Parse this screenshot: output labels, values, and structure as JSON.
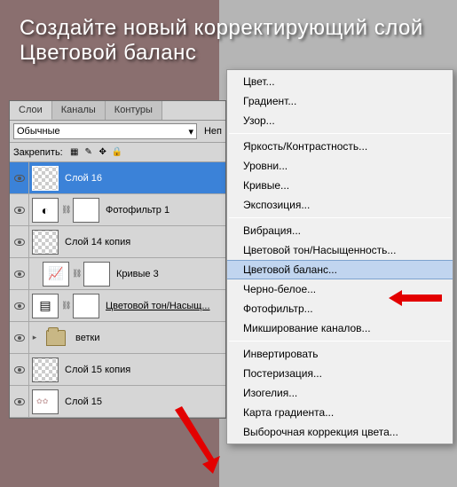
{
  "headline": "Создайте новый корректирующий слой Цветовой баланс",
  "panel": {
    "tabs": [
      "Слои",
      "Каналы",
      "Контуры"
    ],
    "blend_mode": "Обычные",
    "opacity_label": "Неп",
    "lock_label": "Закрепить:"
  },
  "layers": [
    {
      "name": "Слой 16",
      "type": "pixel",
      "selected": true
    },
    {
      "name": "Фотофильтр 1",
      "type": "adj",
      "icon": "◐",
      "link": true
    },
    {
      "name": "Слой 14 копия",
      "type": "pixel"
    },
    {
      "name": "Кривые 3",
      "type": "adj",
      "icon": "📈",
      "link": true,
      "indent": true
    },
    {
      "name": "Цветовой тон/Насыщ...",
      "type": "adj",
      "icon": "▤",
      "link": true,
      "underline": true
    },
    {
      "name": "ветки",
      "type": "folder"
    },
    {
      "name": "Слой 15 копия",
      "type": "pixel"
    },
    {
      "name": "Слой 15",
      "type": "pixel",
      "deco": true
    }
  ],
  "menu": {
    "groups": [
      [
        "Цвет...",
        "Градиент...",
        "Узор..."
      ],
      [
        "Яркость/Контрастность...",
        "Уровни...",
        "Кривые...",
        "Экспозиция..."
      ],
      [
        "Вибрация...",
        "Цветовой тон/Насыщенность...",
        "Цветовой баланс...",
        "Черно-белое...",
        "Фотофильтр...",
        "Микширование каналов..."
      ],
      [
        "Инвертировать",
        "Постеризация...",
        "Изогелия...",
        "Карта градиента...",
        "Выборочная коррекция цвета..."
      ]
    ],
    "highlighted": "Цветовой баланс..."
  }
}
